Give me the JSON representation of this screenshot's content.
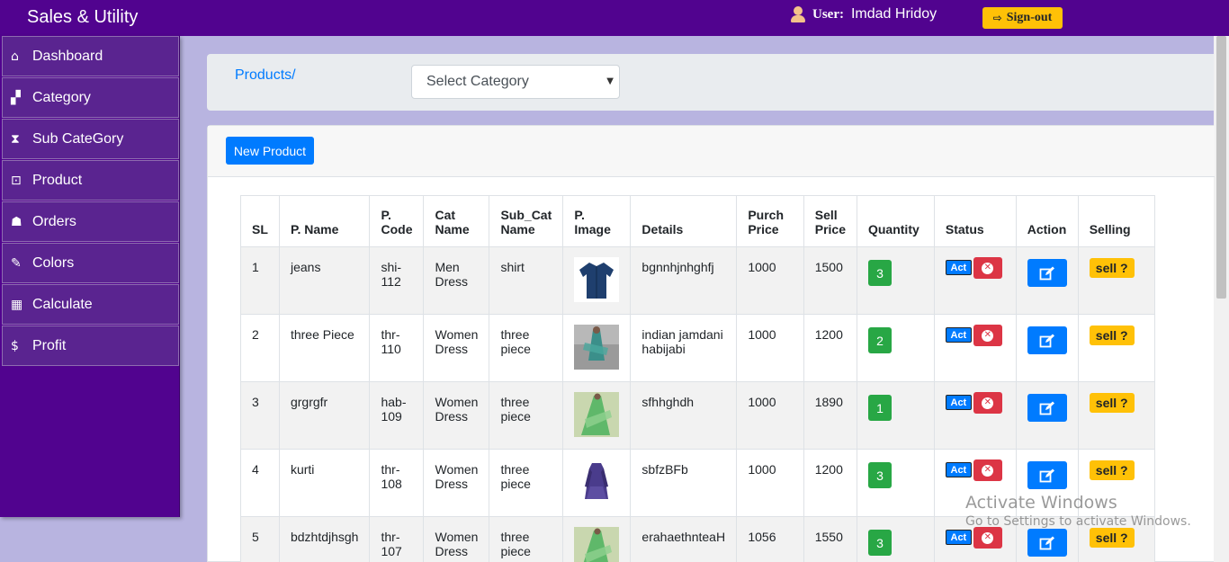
{
  "app": {
    "brand": "Sales & Utility"
  },
  "user": {
    "label": "User:",
    "name": "Imdad Hridoy",
    "signout": "Sign-out"
  },
  "sidebar": {
    "items": [
      {
        "label": "Dashboard",
        "icon": "home-icon"
      },
      {
        "label": "Category",
        "icon": "sitemap-icon"
      },
      {
        "label": "Sub CateGory",
        "icon": "hourglass-icon"
      },
      {
        "label": "Product",
        "icon": "product-icon"
      },
      {
        "label": "Orders",
        "icon": "users-icon"
      },
      {
        "label": "Colors",
        "icon": "brush-icon"
      },
      {
        "label": "Calculate",
        "icon": "calculator-icon"
      },
      {
        "label": "Profit",
        "icon": "dollar-icon"
      }
    ]
  },
  "header": {
    "breadcrumb": "Products/",
    "select_value": "Select Category"
  },
  "toolbar": {
    "new_product": "New Product"
  },
  "table": {
    "columns": [
      "SL",
      "P. Name",
      "P. Code",
      "Cat Name",
      "Sub_Cat Name",
      "P. Image",
      "Details",
      "Purch Price",
      "Sell Price",
      "Quantity",
      "Status",
      "Action",
      "Selling"
    ],
    "rows": [
      {
        "sl": "1",
        "name": "jeans",
        "code": "shi-112",
        "cat": "Men Dress",
        "subcat": "shirt",
        "image": "shirt",
        "details": "bgnnhjnhghfj",
        "purch": "1000",
        "sell": "1500",
        "qty": "3"
      },
      {
        "sl": "2",
        "name": "three Piece",
        "code": "thr-110",
        "cat": "Women Dress",
        "subcat": "three piece",
        "image": "three-piece",
        "details": "indian jamdani habijabi",
        "purch": "1000",
        "sell": "1200",
        "qty": "2"
      },
      {
        "sl": "3",
        "name": "grgrgfr",
        "code": "hab-109",
        "cat": "Women Dress",
        "subcat": "three piece",
        "image": "green-dress",
        "details": "sfhhghdh",
        "purch": "1000",
        "sell": "1890",
        "qty": "1"
      },
      {
        "sl": "4",
        "name": "kurti",
        "code": "thr-108",
        "cat": "Women Dress",
        "subcat": "three piece",
        "image": "kurti",
        "details": "sbfzBFb",
        "purch": "1000",
        "sell": "1200",
        "qty": "3"
      },
      {
        "sl": "5",
        "name": "bdzhtdjhsgh",
        "code": "thr-107",
        "cat": "Women Dress",
        "subcat": "three piece",
        "image": "green-dress",
        "details": "erahaethnteaH",
        "purch": "1056",
        "sell": "1550",
        "qty": "3"
      }
    ],
    "status_act": "Act",
    "sell_label": "sell ?"
  },
  "watermark": {
    "line1": "Activate Windows",
    "line2": "Go to Settings to activate Windows."
  },
  "colors": {
    "primary": "#51038f",
    "blue": "#007bff",
    "green": "#28a745",
    "red": "#dc3545",
    "yellow": "#ffc107"
  }
}
